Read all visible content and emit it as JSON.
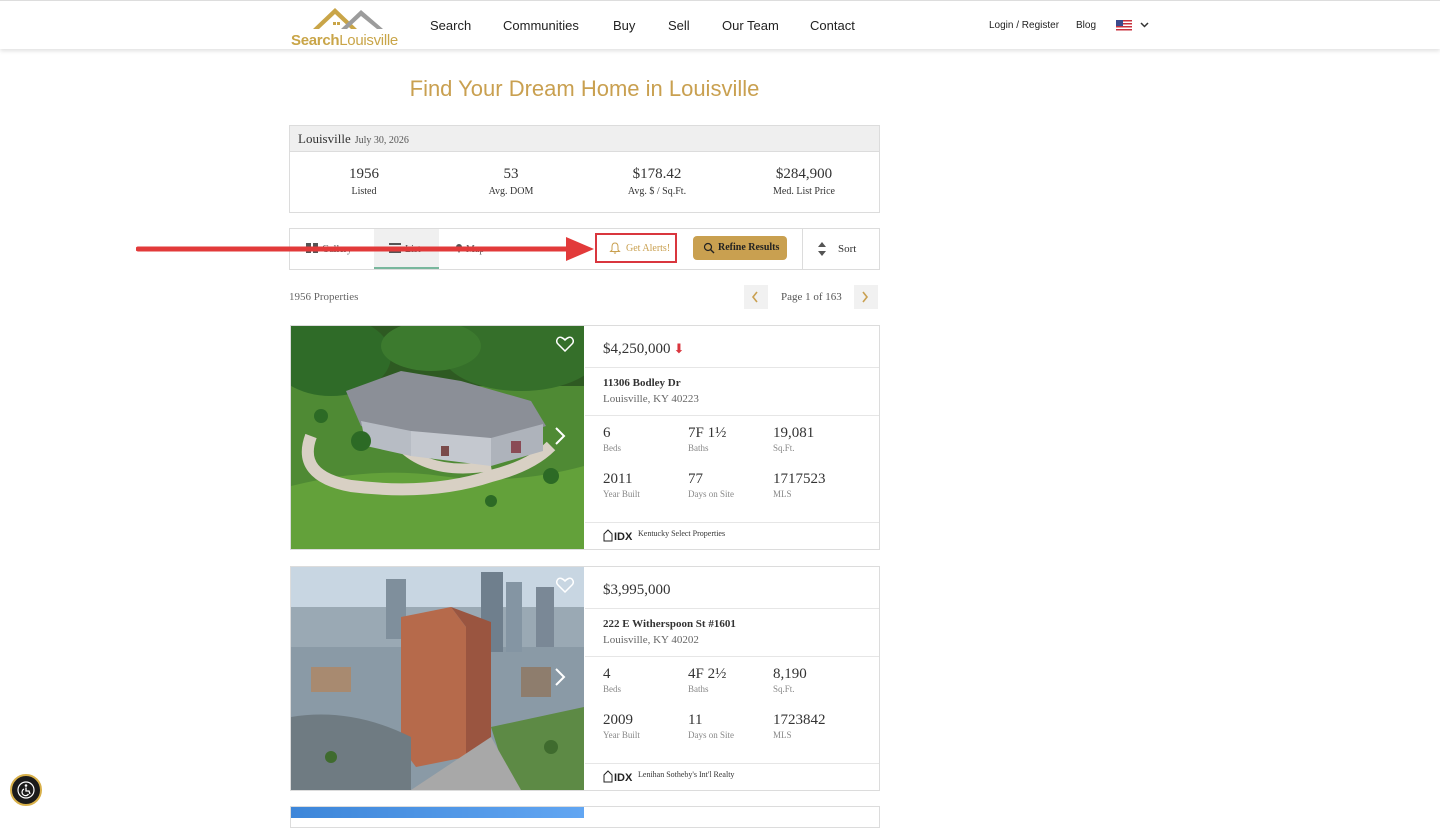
{
  "header": {
    "logo_text_bold": "Search",
    "logo_text_light": "Louisville",
    "nav": [
      "Search",
      "Communities",
      "Buy",
      "Sell",
      "Our Team",
      "Contact"
    ],
    "login": "Login / Register",
    "blog": "Blog",
    "language": "flag-us-icon"
  },
  "page_title": "Find Your Dream Home in Louisville",
  "stats": {
    "city": "Louisville",
    "date": "July 30, 2026",
    "items": [
      {
        "value": "1956",
        "label": "Listed"
      },
      {
        "value": "53",
        "label": "Avg. DOM"
      },
      {
        "value": "$178.42",
        "label": "Avg. $ / Sq.Ft."
      },
      {
        "value": "$284,900",
        "label": "Med. List Price"
      }
    ]
  },
  "toolbar": {
    "views": [
      "Gallery",
      "List",
      "Map"
    ],
    "active_view": "List",
    "alert_label": "Get Alerts!",
    "refine_label": "Refine Results",
    "sort_label": "Sort"
  },
  "results": {
    "count": "1956 Properties",
    "page": "Page 1 of 163"
  },
  "listings": [
    {
      "price": "$4,250,000",
      "price_down": "⬇",
      "street": "11306 Bodley Dr",
      "city": "Louisville, KY 40223",
      "beds": "6",
      "beds_label": "Beds",
      "baths": "7F 1½",
      "baths_label": "Baths",
      "sqft": "19,081",
      "sqft_label": "Sq.Ft.",
      "year": "2011",
      "year_label": "Year Built",
      "dom": "77",
      "dom_label": "Days on Site",
      "mls": "1717523",
      "mls_label": "MLS",
      "broker": "Kentucky Select Properties"
    },
    {
      "price": "$3,995,000",
      "street": "222 E Witherspoon St #1601",
      "city": "Louisville, KY 40202",
      "beds": "4",
      "beds_label": "Beds",
      "baths": "4F 2½",
      "baths_label": "Baths",
      "sqft": "8,190",
      "sqft_label": "Sq.Ft.",
      "year": "2009",
      "year_label": "Year Built",
      "dom": "11",
      "dom_label": "Days on Site",
      "mls": "1723842",
      "mls_label": "MLS",
      "broker": "Lenihan Sotheby's Int'l Realty"
    }
  ],
  "colors": {
    "brand_gold": "#c9a050",
    "highlight_red": "#d9363e",
    "active_tab_green": "#79b79d"
  }
}
